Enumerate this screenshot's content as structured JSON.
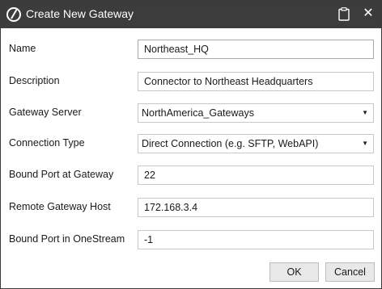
{
  "window": {
    "title": "Create New Gateway",
    "app_icon": "onestream-logo-icon",
    "clipboard_icon": "clipboard-icon",
    "close_label": "✕"
  },
  "form": {
    "name": {
      "label": "Name",
      "value": "Northeast_HQ"
    },
    "description": {
      "label": "Description",
      "value": "Connector to Northeast Headquarters"
    },
    "gateway_server": {
      "label": "Gateway Server",
      "value": "NorthAmerica_Gateways"
    },
    "connection_type": {
      "label": "Connection Type",
      "value": "Direct Connection (e.g. SFTP, WebAPI)"
    },
    "bound_port_gateway": {
      "label": "Bound Port at Gateway",
      "value": "22"
    },
    "remote_gateway_host": {
      "label": "Remote Gateway Host",
      "value": "172.168.3.4"
    },
    "bound_port_onestream": {
      "label": "Bound Port in OneStream",
      "value": "-1"
    }
  },
  "buttons": {
    "ok": "OK",
    "cancel": "Cancel"
  },
  "colors": {
    "titlebar": "#3c3c3c",
    "button_bg": "#e8e8e8",
    "field_border": "#c8c8c8"
  }
}
